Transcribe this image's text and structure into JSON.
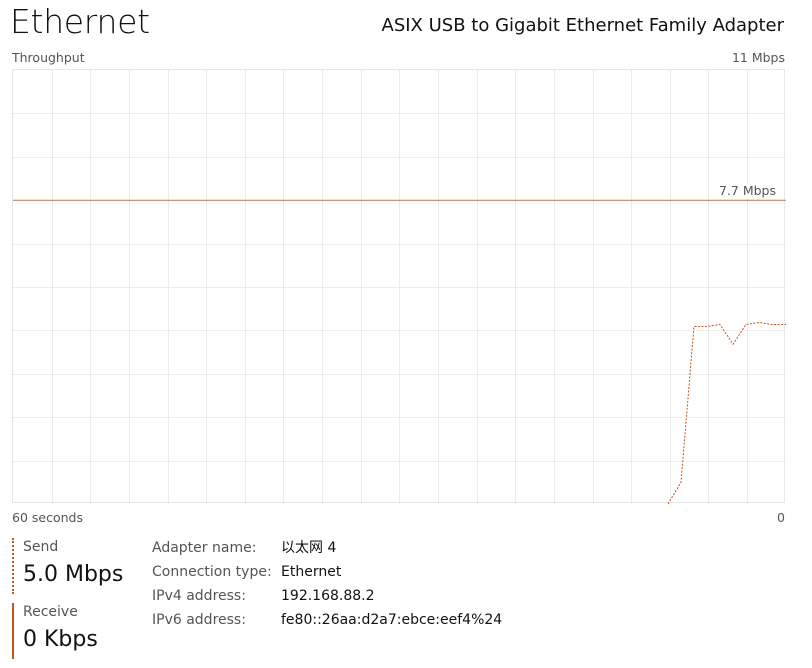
{
  "header": {
    "title": "Ethernet",
    "adapter_description": "ASIX USB to Gigabit Ethernet Family Adapter"
  },
  "graph": {
    "label": "Throughput",
    "max_label": "11 Mbps",
    "time_label": "60 seconds",
    "min_label": "0",
    "reference_label": "7.7 Mbps",
    "line_color": "#c9531f",
    "reference_color": "#b97a55"
  },
  "chart_data": {
    "type": "line",
    "x": [
      0,
      1,
      2,
      3,
      4,
      5,
      6,
      7,
      8,
      9
    ],
    "xlim": [
      60,
      0
    ],
    "series": [
      {
        "values": [
          0,
          0.55,
          4.5,
          4.5,
          4.55,
          4.05,
          4.55,
          4.6,
          4.55,
          4.55
        ]
      }
    ],
    "ylim": [
      0,
      11
    ],
    "reference_line": 7.7,
    "grid": true
  },
  "stats": {
    "send_label": "Send",
    "send_value": "5.0 Mbps",
    "receive_label": "Receive",
    "receive_value": "0 Kbps"
  },
  "details": {
    "adapter_name_label": "Adapter name:",
    "adapter_name_value": "以太网 4",
    "connection_type_label": "Connection type:",
    "connection_type_value": "Ethernet",
    "ipv4_label": "IPv4 address:",
    "ipv4_value": "192.168.88.2",
    "ipv6_label": "IPv6 address:",
    "ipv6_value": "fe80::26aa:d2a7:ebce:eef4%24"
  }
}
